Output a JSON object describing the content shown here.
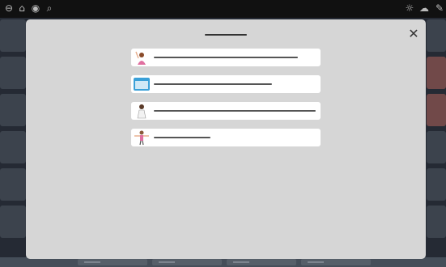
{
  "toolbar": {
    "icons": [
      "back-icon",
      "home-icon",
      "camera-icon",
      "search-icon",
      "sun-icon",
      "cloud-icon",
      "tools-icon"
    ]
  },
  "modal": {
    "options": [
      {
        "image": "waving-woman-icon"
      },
      {
        "image": "calendar-day-icon"
      },
      {
        "image": "doctor-icon"
      },
      {
        "image": "arms-out-person-icon"
      }
    ]
  },
  "colors": {
    "modal_bg": "#d6d6d6",
    "option_bg": "#ffffff",
    "scrim": "#2e3440"
  }
}
